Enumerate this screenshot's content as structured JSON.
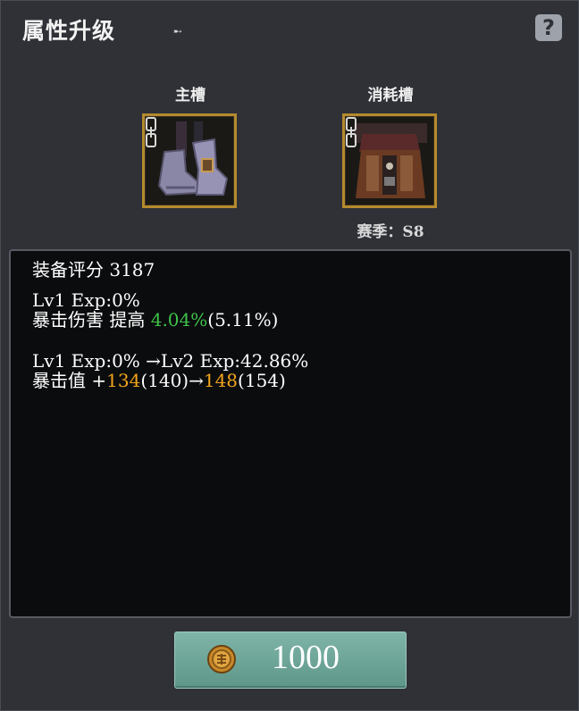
{
  "title": "属性升级",
  "cursor_glyph": "➸",
  "help_label": "?",
  "main_slot": {
    "label": "主槽"
  },
  "consume_slot": {
    "label": "消耗槽",
    "season": "赛季：S8"
  },
  "stats": {
    "score_line": "装备评分 3187",
    "current_level": "Lv1 Exp:0%",
    "crit_damage_label": "暴击伤害 提高 ",
    "crit_damage_value": "4.04%",
    "crit_damage_max": "(5.11%)",
    "upgrade_level": "Lv1 Exp:0% →Lv2 Exp:42.86%",
    "crit_value_label": "暴击值 +",
    "crit_value_from": "134",
    "crit_value_from_max": "(140)→",
    "crit_value_to": "148",
    "crit_value_to_max": "(154)"
  },
  "cost": {
    "amount": "1000",
    "currency_icon": "gold-coin-icon"
  },
  "colors": {
    "positive": "#3fc34a",
    "highlight": "#f3a51b",
    "button": "#6fa699",
    "slot_border": "#b58a2e"
  }
}
